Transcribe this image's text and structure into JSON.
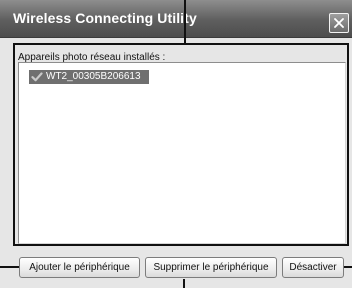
{
  "window": {
    "title": "Wireless Connecting Utility",
    "close_icon": "close-icon"
  },
  "panel": {
    "label": "Appareils photo réseau installés :",
    "items": [
      {
        "label": "WT2_00305B206613",
        "icon": "check-icon",
        "selected": true
      }
    ]
  },
  "buttons": {
    "add_label": "Ajouter le périphérique",
    "remove_label": "Supprimer le périphérique",
    "disable_label": "Désactiver"
  }
}
